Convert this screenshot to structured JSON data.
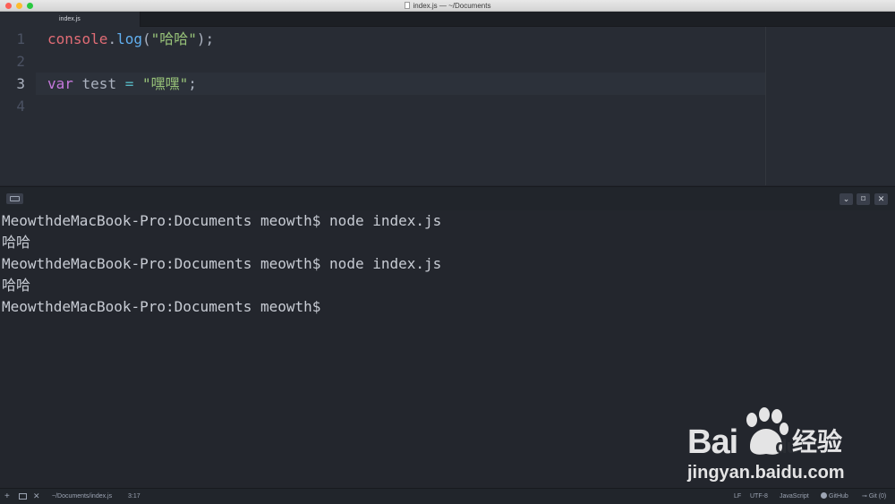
{
  "window": {
    "title": "index.js — ~/Documents"
  },
  "tabs": [
    {
      "label": "index.js"
    }
  ],
  "editor": {
    "line_numbers": [
      "1",
      "2",
      "3",
      "4"
    ],
    "line1": {
      "t1": "console",
      "t2": ".",
      "t3": "log",
      "t4": "(",
      "t5": "\"哈哈\"",
      "t6": ");"
    },
    "line3": {
      "t1": "var",
      "t2": " test ",
      "t3": "=",
      "t4": " ",
      "t5": "\"嘿嘿\"",
      "t6": ";"
    }
  },
  "terminal": {
    "buttons": {
      "hide": "⌄",
      "maximize": "⌑",
      "close": "✕"
    },
    "lines": [
      "MeowthdeMacBook-Pro:Documents meowth$ node index.js",
      "哈哈",
      "MeowthdeMacBook-Pro:Documents meowth$ node index.js",
      "哈哈",
      "MeowthdeMacBook-Pro:Documents meowth$"
    ]
  },
  "watermark": {
    "brand": "Bai",
    "du_mark": "du",
    "product": "经验",
    "url": "jingyan.baidu.com"
  },
  "statusbar": {
    "add": "+",
    "close": "✕",
    "path": "~/Documents/index.js",
    "cursor": "3:17",
    "line_ending": "LF",
    "encoding": "UTF-8",
    "grammar": "JavaScript",
    "github": "GitHub",
    "git": "Git (0)"
  },
  "colors": {
    "editor_bg": "#282c34",
    "keyword": "#c678dd",
    "string": "#98c379",
    "function": "#61afef",
    "variable": "#e06c75"
  }
}
